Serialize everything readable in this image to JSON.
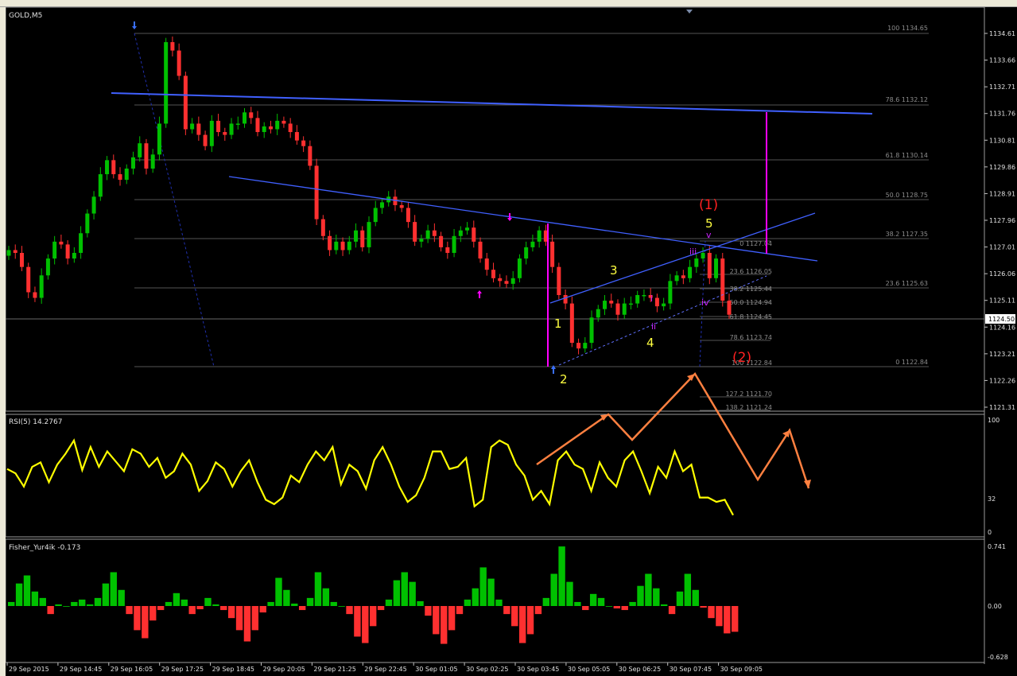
{
  "window": {
    "title": "GOLD,M5"
  },
  "price_panel": {
    "title": "GOLD,M5",
    "current_price": "1124.50",
    "price_ticks": [
      "1134.61",
      "1133.66",
      "1132.71",
      "1131.76",
      "1130.81",
      "1129.86",
      "1128.91",
      "1127.96",
      "1127.01",
      "1126.06",
      "1125.11",
      "1124.16",
      "1123.21",
      "1122.26",
      "1121.31"
    ],
    "fib_main": [
      "100 1134.65",
      "78.6 1132.12",
      "61.8 1130.14",
      "50.0 1128.75",
      "38.2 1127.35",
      "23.6 1125.63",
      "0 1122.84"
    ],
    "fib_inner": [
      "0 1127.04",
      "23.6 1126.05",
      "38.2 1125.44",
      "50.0 1124.94",
      "61.8 1124.45",
      "78.6 1123.74",
      "100 1122.84",
      "127.2 1121.70",
      "138.2 1121.24"
    ],
    "wave_labels": {
      "w1": "1",
      "w2": "2",
      "w3": "3",
      "w4": "4",
      "w5": "5",
      "big1": "(1)",
      "big2": "(2)",
      "si": "i",
      "sii": "ii",
      "siii": "iii",
      "siv": "iv",
      "sv": "v"
    }
  },
  "rsi_panel": {
    "title": "RSI(5) 14.2767",
    "ticks": [
      "100",
      "32",
      "0"
    ]
  },
  "fisher_panel": {
    "title": "Fisher_Yur4ik -0.173",
    "ticks": [
      "0.741",
      "0.00",
      "-0.628"
    ]
  },
  "time_axis": [
    "29 Sep 2015",
    "29 Sep 14:45",
    "29 Sep 16:05",
    "29 Sep 17:25",
    "29 Sep 18:45",
    "29 Sep 20:05",
    "29 Sep 21:25",
    "29 Sep 22:45",
    "30 Sep 01:05",
    "30 Sep 02:25",
    "30 Sep 03:45",
    "30 Sep 05:05",
    "30 Sep 06:25",
    "30 Sep 07:45",
    "30 Sep 09:05"
  ],
  "colors": {
    "background": "#000000",
    "bull": "#00c000",
    "bear": "#ff3030",
    "rsi": "#ffff00",
    "trend": "#4060ff",
    "magenta": "#ff00ff",
    "projection": "#ff8040",
    "fib": "#707070",
    "wave_yellow": "#ffff40",
    "wave_red": "#ff2020"
  },
  "chart_data": [
    {
      "type": "line",
      "title": "GOLD,M5",
      "ylim": [
        1121.0,
        1135.0
      ],
      "series": [
        {
          "values": [
            1126.9,
            1126.8,
            1126.3,
            1125.4,
            1125.2,
            1126.0,
            1126.6,
            1127.2,
            1127.1,
            1126.6,
            1126.8,
            1127.5,
            1128.2,
            1128.8,
            1129.6,
            1130.1,
            1129.6,
            1129.4,
            1129.8,
            1130.2,
            1130.7,
            1129.8,
            1130.3,
            1131.4,
            1134.3,
            1134.0,
            1133.1,
            1131.2,
            1131.4,
            1131.0,
            1130.6,
            1131.5,
            1131.1,
            1131.0,
            1131.4,
            1131.4,
            1131.8,
            1131.6,
            1131.1,
            1131.3,
            1131.2,
            1131.5,
            1131.4,
            1131.1,
            1130.8,
            1130.6,
            1129.9,
            1128.0,
            1127.4,
            1126.9,
            1127.2,
            1126.9,
            1127.2,
            1127.6,
            1127.0,
            1127.9,
            1128.4,
            1128.6,
            1128.8,
            1128.5,
            1128.4,
            1127.9,
            1127.2,
            1127.3,
            1127.6,
            1127.4,
            1127.0,
            1126.8,
            1127.4,
            1127.6,
            1127.7,
            1127.2,
            1126.6,
            1126.2,
            1125.9,
            1125.8,
            1125.7,
            1125.9,
            1126.6,
            1127.0,
            1127.2,
            1127.6,
            1127.2,
            1126.3,
            1125.3,
            1125.0,
            1123.6,
            1123.4,
            1123.6,
            1124.5,
            1124.8,
            1125.1,
            1125.0,
            1124.6,
            1125.0,
            1125.0,
            1125.3,
            1125.3,
            1125.2,
            1124.9,
            1125.0,
            1125.8,
            1126.0,
            1125.9,
            1126.3,
            1126.6,
            1126.8,
            1125.9,
            1126.6,
            1125.1,
            1124.6
          ]
        }
      ]
    },
    {
      "type": "line",
      "title": "RSI(5) 14.2767",
      "ylim": [
        0,
        100
      ],
      "series": [
        {
          "values": [
            56,
            52,
            40,
            58,
            62,
            44,
            60,
            70,
            82,
            55,
            76,
            58,
            72,
            63,
            54,
            74,
            70,
            58,
            66,
            48,
            54,
            70,
            60,
            36,
            45,
            62,
            56,
            40,
            54,
            64,
            44,
            28,
            24,
            30,
            50,
            44,
            60,
            72,
            64,
            76,
            42,
            60,
            54,
            38,
            64,
            76,
            60,
            40,
            26,
            32,
            48,
            72,
            72,
            56,
            58,
            66,
            22,
            28,
            76,
            82,
            78,
            60,
            50,
            28,
            36,
            24,
            64,
            72,
            60,
            56,
            36,
            62,
            48,
            40,
            64,
            72,
            54,
            34,
            58,
            48,
            72,
            54,
            60,
            30,
            30,
            26,
            28,
            14
          ]
        }
      ]
    },
    {
      "type": "bar",
      "title": "Fisher_Yur4ik -0.173",
      "ylim": [
        -0.628,
        0.741
      ],
      "series": [
        {
          "values": [
            0.05,
            0.28,
            0.38,
            0.18,
            0.1,
            -0.1,
            0.02,
            0.0,
            0.05,
            0.08,
            0.02,
            0.1,
            0.28,
            0.42,
            0.2,
            -0.1,
            -0.3,
            -0.4,
            -0.18,
            -0.05,
            0.05,
            0.16,
            0.08,
            -0.1,
            -0.04,
            0.1,
            0.02,
            -0.05,
            -0.15,
            -0.3,
            -0.44,
            -0.3,
            -0.08,
            0.05,
            0.35,
            0.2,
            0.03,
            -0.05,
            0.1,
            0.42,
            0.22,
            0.05,
            0.0,
            -0.1,
            -0.38,
            -0.46,
            -0.25,
            -0.05,
            0.08,
            0.32,
            0.42,
            0.3,
            0.06,
            -0.12,
            -0.35,
            -0.47,
            -0.3,
            -0.1,
            0.08,
            0.22,
            0.48,
            0.34,
            0.08,
            -0.1,
            -0.25,
            -0.46,
            -0.35,
            -0.1,
            0.1,
            0.4,
            0.74,
            0.3,
            0.05,
            -0.05,
            0.15,
            0.1,
            0.0,
            -0.03,
            -0.05,
            0.05,
            0.25,
            0.4,
            0.22,
            0.02,
            -0.1,
            0.18,
            0.4,
            0.2,
            -0.02,
            -0.15,
            -0.25,
            -0.34,
            -0.32
          ]
        }
      ]
    }
  ]
}
